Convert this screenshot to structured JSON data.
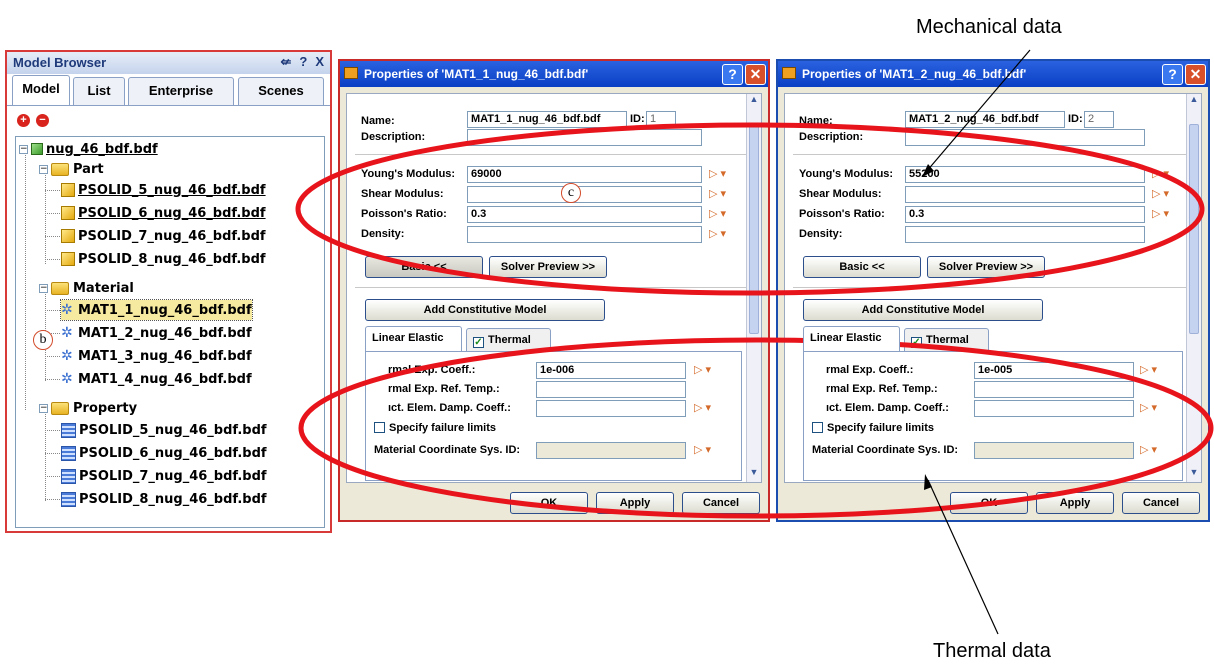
{
  "model_browser": {
    "title": "Model Browser",
    "controls": [
      "\u0004",
      "?",
      "X"
    ],
    "tabs": [
      "Model",
      "List",
      "Enterprise",
      "Scenes"
    ],
    "tree": {
      "root": "nug_46_bdf.bdf",
      "part_folder": "Part",
      "parts": [
        "PSOLID_5_nug_46_bdf.bdf",
        "PSOLID_6_nug_46_bdf.bdf",
        "PSOLID_7_nug_46_bdf.bdf",
        "PSOLID_8_nug_46_bdf.bdf"
      ],
      "material_folder": "Material",
      "materials": [
        "MAT1_1_nug_46_bdf.bdf",
        "MAT1_2_nug_46_bdf.bdf",
        "MAT1_3_nug_46_bdf.bdf",
        "MAT1_4_nug_46_bdf.bdf"
      ],
      "property_folder": "Property",
      "properties": [
        "PSOLID_5_nug_46_bdf.bdf",
        "PSOLID_6_nug_46_bdf.bdf",
        "PSOLID_7_nug_46_bdf.bdf",
        "PSOLID_8_nug_46_bdf.bdf"
      ]
    }
  },
  "dialog1": {
    "title": "Properties of 'MAT1_1_nug_46_bdf.bdf'",
    "name_label": "Name:",
    "name_value": "MAT1_1_nug_46_bdf.bdf",
    "id_label": "ID:",
    "id_value": "1",
    "description_label": "Description:",
    "youngs_label": "Young's Modulus:",
    "youngs_value": "69000",
    "shear_label": "Shear Modulus:",
    "poisson_label": "Poisson's Ratio:",
    "poisson_value": "0.3",
    "density_label": "Density:",
    "basic_btn": "Basic <<",
    "solver_btn": "Solver Preview >>",
    "add_btn": "Add Constitutive Model",
    "tab_linear": "Linear Elastic",
    "tab_thermal": "Thermal",
    "thermal_coeff_label": "rmal Exp. Coeff.:",
    "thermal_coeff_value": "1e-006",
    "thermal_ref_label": "rmal Exp. Ref. Temp.:",
    "damp_label": "ıct. Elem. Damp. Coeff.:",
    "failure_label": "Specify failure limits",
    "coord_label": "Material Coordinate Sys. ID:",
    "ok": "OK",
    "apply": "Apply",
    "cancel": "Cancel"
  },
  "dialog2": {
    "title": "Properties of 'MAT1_2_nug_46_bdf.bdf'",
    "name_label": "Name:",
    "name_value": "MAT1_2_nug_46_bdf.bdf",
    "id_label": "ID:",
    "id_value": "2",
    "description_label": "Description:",
    "youngs_label": "Young's Modulus:",
    "youngs_value": "55200",
    "shear_label": "Shear Modulus:",
    "poisson_label": "Poisson's Ratio:",
    "poisson_value": "0.3",
    "density_label": "Density:",
    "basic_btn": "Basic <<",
    "solver_btn": "Solver Preview >>",
    "add_btn": "Add Constitutive Model",
    "tab_linear": "Linear Elastic",
    "tab_thermal": "Thermal",
    "thermal_coeff_label": "rmal Exp. Coeff.:",
    "thermal_coeff_value": "1e-005",
    "thermal_ref_label": "rmal Exp. Ref. Temp.:",
    "damp_label": "ıct. Elem. Damp. Coeff.:",
    "failure_label": "Specify failure limits",
    "coord_label": "Material Coordinate Sys. ID:",
    "ok": "OK",
    "apply": "Apply",
    "cancel": "Cancel"
  },
  "annotations": {
    "mechanical": "Mechanical data",
    "thermal": "Thermal data",
    "b": "b",
    "c": "c"
  },
  "colors": {
    "highlight": "#e8141c",
    "title_bar": "#0a3fc4",
    "dialog_bg": "#ece9d8"
  }
}
